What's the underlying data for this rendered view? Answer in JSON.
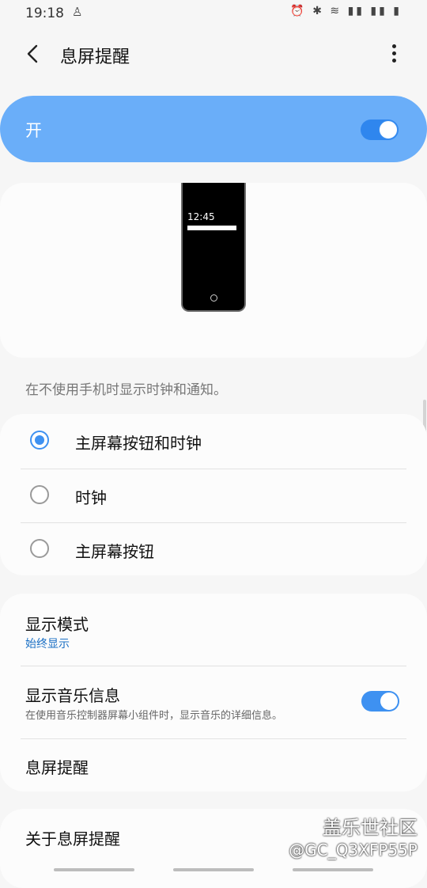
{
  "status_bar": {
    "time": "19:18",
    "icons": "⏰ ✱ ≋ ▮▮ ▮▮ ▮"
  },
  "header": {
    "title": "息屏提醒"
  },
  "master_switch": {
    "label": "开",
    "on": true
  },
  "preview": {
    "clock": "12:45"
  },
  "description": "在不使用手机时显示时钟和通知。",
  "options": [
    {
      "label": "主屏幕按钮和时钟",
      "selected": true
    },
    {
      "label": "时钟",
      "selected": false
    },
    {
      "label": "主屏幕按钮",
      "selected": false
    }
  ],
  "settings": {
    "display_mode": {
      "title": "显示模式",
      "value": "始终显示"
    },
    "music_info": {
      "title": "显示音乐信息",
      "desc": "在使用音乐控制器屏幕小组件时，显示音乐的详细信息。",
      "on": true
    },
    "aod": {
      "title": "息屏提醒"
    }
  },
  "about": {
    "title": "关于息屏提醒"
  },
  "watermark": {
    "line1": "盖乐世社区",
    "line2": "@GC_Q3XFP55P"
  },
  "colors": {
    "accent": "#3e91f1",
    "master_bg": "#6aaef9",
    "link": "#1a6fc4"
  }
}
